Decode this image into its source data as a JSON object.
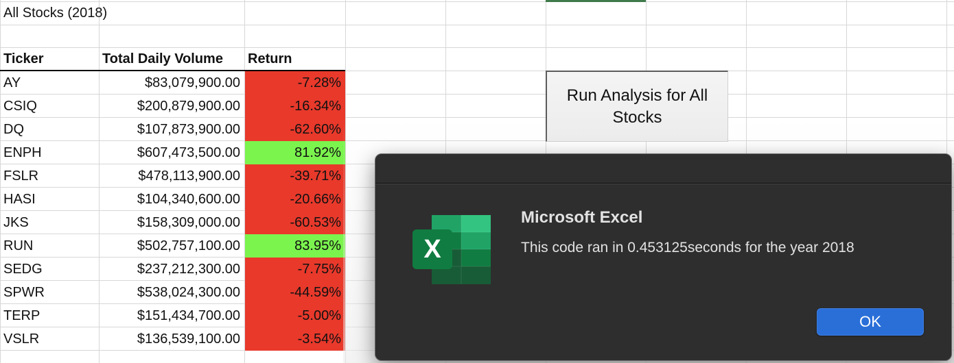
{
  "sheet": {
    "title": "All Stocks (2018)",
    "headers": {
      "ticker": "Ticker",
      "volume": "Total Daily Volume",
      "return": "Return"
    },
    "rows": [
      {
        "ticker": "AY",
        "volume": "$83,079,900.00",
        "return": "-7.28%",
        "status": "negative"
      },
      {
        "ticker": "CSIQ",
        "volume": "$200,879,900.00",
        "return": "-16.34%",
        "status": "negative"
      },
      {
        "ticker": "DQ",
        "volume": "$107,873,900.00",
        "return": "-62.60%",
        "status": "negative"
      },
      {
        "ticker": "ENPH",
        "volume": "$607,473,500.00",
        "return": "81.92%",
        "status": "positive"
      },
      {
        "ticker": "FSLR",
        "volume": "$478,113,900.00",
        "return": "-39.71%",
        "status": "negative"
      },
      {
        "ticker": "HASI",
        "volume": "$104,340,600.00",
        "return": "-20.66%",
        "status": "negative"
      },
      {
        "ticker": "JKS",
        "volume": "$158,309,000.00",
        "return": "-60.53%",
        "status": "negative"
      },
      {
        "ticker": "RUN",
        "volume": "$502,757,100.00",
        "return": "83.95%",
        "status": "positive"
      },
      {
        "ticker": "SEDG",
        "volume": "$237,212,300.00",
        "return": "-7.75%",
        "status": "negative"
      },
      {
        "ticker": "SPWR",
        "volume": "$538,024,300.00",
        "return": "-44.59%",
        "status": "negative"
      },
      {
        "ticker": "TERP",
        "volume": "$151,434,700.00",
        "return": "-5.00%",
        "status": "negative"
      },
      {
        "ticker": "VSLR",
        "volume": "$136,539,100.00",
        "return": "-3.54%",
        "status": "negative"
      }
    ]
  },
  "macro_button": {
    "label": "Run Analysis for All Stocks"
  },
  "dialog": {
    "title": "Microsoft Excel",
    "message": "This code ran in 0.453125seconds for the year 2018",
    "ok_label": "OK",
    "icon": "excel-icon",
    "icon_letter": "X"
  },
  "colors": {
    "negative": "#e8392b",
    "positive": "#7bf44e",
    "ok_button": "#2a6fd8",
    "dialog_bg": "#2e2e2e",
    "excel_green": "#1e7145"
  }
}
